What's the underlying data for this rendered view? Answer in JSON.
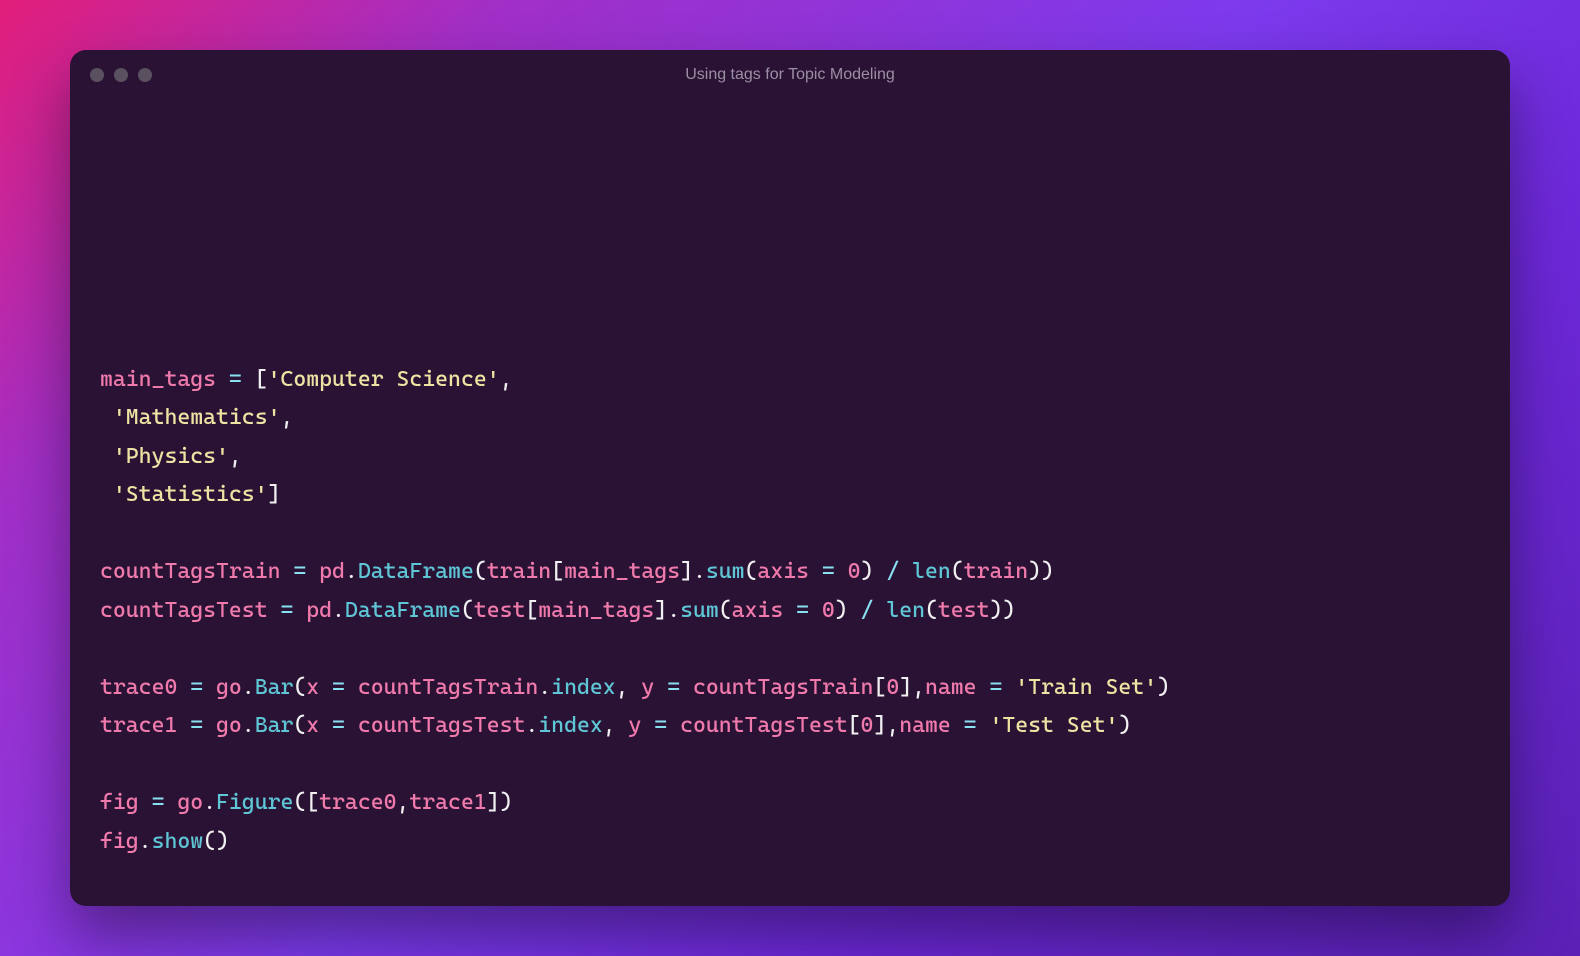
{
  "window": {
    "title": "Using tags for Topic Modeling"
  },
  "code": {
    "tokens": [
      [
        {
          "t": "",
          "c": "\n"
        }
      ],
      [
        {
          "t": "",
          "c": "\n"
        }
      ],
      [
        {
          "t": "",
          "c": "\n"
        }
      ],
      [
        {
          "t": "var",
          "c": "main_tags"
        },
        {
          "t": "",
          "c": " "
        },
        {
          "t": "op",
          "c": "="
        },
        {
          "t": "",
          "c": " "
        },
        {
          "t": "punct",
          "c": "["
        },
        {
          "t": "str",
          "c": "'Computer Science'"
        },
        {
          "t": "punct",
          "c": ","
        }
      ],
      [
        {
          "t": "",
          "c": " "
        },
        {
          "t": "str",
          "c": "'Mathematics'"
        },
        {
          "t": "punct",
          "c": ","
        }
      ],
      [
        {
          "t": "",
          "c": " "
        },
        {
          "t": "str",
          "c": "'Physics'"
        },
        {
          "t": "punct",
          "c": ","
        }
      ],
      [
        {
          "t": "",
          "c": " "
        },
        {
          "t": "str",
          "c": "'Statistics'"
        },
        {
          "t": "punct",
          "c": "]"
        }
      ],
      [
        {
          "t": "",
          "c": ""
        }
      ],
      [
        {
          "t": "var",
          "c": "countTagsTrain"
        },
        {
          "t": "",
          "c": " "
        },
        {
          "t": "op",
          "c": "="
        },
        {
          "t": "",
          "c": " "
        },
        {
          "t": "obj",
          "c": "pd"
        },
        {
          "t": "punct",
          "c": "."
        },
        {
          "t": "method",
          "c": "DataFrame"
        },
        {
          "t": "punct",
          "c": "("
        },
        {
          "t": "obj",
          "c": "train"
        },
        {
          "t": "punct",
          "c": "["
        },
        {
          "t": "var",
          "c": "main_tags"
        },
        {
          "t": "punct",
          "c": "]"
        },
        {
          "t": "punct",
          "c": "."
        },
        {
          "t": "method",
          "c": "sum"
        },
        {
          "t": "punct",
          "c": "("
        },
        {
          "t": "param",
          "c": "axis"
        },
        {
          "t": "",
          "c": " "
        },
        {
          "t": "op",
          "c": "="
        },
        {
          "t": "",
          "c": " "
        },
        {
          "t": "num",
          "c": "0"
        },
        {
          "t": "punct",
          "c": ")"
        },
        {
          "t": "",
          "c": " "
        },
        {
          "t": "op",
          "c": "/"
        },
        {
          "t": "",
          "c": " "
        },
        {
          "t": "func",
          "c": "len"
        },
        {
          "t": "punct",
          "c": "("
        },
        {
          "t": "obj",
          "c": "train"
        },
        {
          "t": "punct",
          "c": "))"
        }
      ],
      [
        {
          "t": "var",
          "c": "countTagsTest"
        },
        {
          "t": "",
          "c": " "
        },
        {
          "t": "op",
          "c": "="
        },
        {
          "t": "",
          "c": " "
        },
        {
          "t": "obj",
          "c": "pd"
        },
        {
          "t": "punct",
          "c": "."
        },
        {
          "t": "method",
          "c": "DataFrame"
        },
        {
          "t": "punct",
          "c": "("
        },
        {
          "t": "obj",
          "c": "test"
        },
        {
          "t": "punct",
          "c": "["
        },
        {
          "t": "var",
          "c": "main_tags"
        },
        {
          "t": "punct",
          "c": "]"
        },
        {
          "t": "punct",
          "c": "."
        },
        {
          "t": "method",
          "c": "sum"
        },
        {
          "t": "punct",
          "c": "("
        },
        {
          "t": "param",
          "c": "axis"
        },
        {
          "t": "",
          "c": " "
        },
        {
          "t": "op",
          "c": "="
        },
        {
          "t": "",
          "c": " "
        },
        {
          "t": "num",
          "c": "0"
        },
        {
          "t": "punct",
          "c": ")"
        },
        {
          "t": "",
          "c": " "
        },
        {
          "t": "op",
          "c": "/"
        },
        {
          "t": "",
          "c": " "
        },
        {
          "t": "func",
          "c": "len"
        },
        {
          "t": "punct",
          "c": "("
        },
        {
          "t": "obj",
          "c": "test"
        },
        {
          "t": "punct",
          "c": "))"
        }
      ],
      [
        {
          "t": "",
          "c": ""
        }
      ],
      [
        {
          "t": "var",
          "c": "trace0"
        },
        {
          "t": "",
          "c": " "
        },
        {
          "t": "op",
          "c": "="
        },
        {
          "t": "",
          "c": " "
        },
        {
          "t": "obj",
          "c": "go"
        },
        {
          "t": "punct",
          "c": "."
        },
        {
          "t": "method",
          "c": "Bar"
        },
        {
          "t": "punct",
          "c": "("
        },
        {
          "t": "param",
          "c": "x"
        },
        {
          "t": "",
          "c": " "
        },
        {
          "t": "op",
          "c": "="
        },
        {
          "t": "",
          "c": " "
        },
        {
          "t": "obj",
          "c": "countTagsTrain"
        },
        {
          "t": "punct",
          "c": "."
        },
        {
          "t": "method",
          "c": "index"
        },
        {
          "t": "punct",
          "c": ","
        },
        {
          "t": "",
          "c": " "
        },
        {
          "t": "param",
          "c": "y"
        },
        {
          "t": "",
          "c": " "
        },
        {
          "t": "op",
          "c": "="
        },
        {
          "t": "",
          "c": " "
        },
        {
          "t": "obj",
          "c": "countTagsTrain"
        },
        {
          "t": "punct",
          "c": "["
        },
        {
          "t": "num",
          "c": "0"
        },
        {
          "t": "punct",
          "c": "],"
        },
        {
          "t": "param",
          "c": "name"
        },
        {
          "t": "",
          "c": " "
        },
        {
          "t": "op",
          "c": "="
        },
        {
          "t": "",
          "c": " "
        },
        {
          "t": "str",
          "c": "'Train Set'"
        },
        {
          "t": "punct",
          "c": ")"
        }
      ],
      [
        {
          "t": "var",
          "c": "trace1"
        },
        {
          "t": "",
          "c": " "
        },
        {
          "t": "op",
          "c": "="
        },
        {
          "t": "",
          "c": " "
        },
        {
          "t": "obj",
          "c": "go"
        },
        {
          "t": "punct",
          "c": "."
        },
        {
          "t": "method",
          "c": "Bar"
        },
        {
          "t": "punct",
          "c": "("
        },
        {
          "t": "param",
          "c": "x"
        },
        {
          "t": "",
          "c": " "
        },
        {
          "t": "op",
          "c": "="
        },
        {
          "t": "",
          "c": " "
        },
        {
          "t": "obj",
          "c": "countTagsTest"
        },
        {
          "t": "punct",
          "c": "."
        },
        {
          "t": "method",
          "c": "index"
        },
        {
          "t": "punct",
          "c": ","
        },
        {
          "t": "",
          "c": " "
        },
        {
          "t": "param",
          "c": "y"
        },
        {
          "t": "",
          "c": " "
        },
        {
          "t": "op",
          "c": "="
        },
        {
          "t": "",
          "c": " "
        },
        {
          "t": "obj",
          "c": "countTagsTest"
        },
        {
          "t": "punct",
          "c": "["
        },
        {
          "t": "num",
          "c": "0"
        },
        {
          "t": "punct",
          "c": "],"
        },
        {
          "t": "param",
          "c": "name"
        },
        {
          "t": "",
          "c": " "
        },
        {
          "t": "op",
          "c": "="
        },
        {
          "t": "",
          "c": " "
        },
        {
          "t": "str",
          "c": "'Test Set'"
        },
        {
          "t": "punct",
          "c": ")"
        }
      ],
      [
        {
          "t": "",
          "c": ""
        }
      ],
      [
        {
          "t": "var",
          "c": "fig"
        },
        {
          "t": "",
          "c": " "
        },
        {
          "t": "op",
          "c": "="
        },
        {
          "t": "",
          "c": " "
        },
        {
          "t": "obj",
          "c": "go"
        },
        {
          "t": "punct",
          "c": "."
        },
        {
          "t": "method",
          "c": "Figure"
        },
        {
          "t": "punct",
          "c": "(["
        },
        {
          "t": "obj",
          "c": "trace0"
        },
        {
          "t": "punct",
          "c": ","
        },
        {
          "t": "obj",
          "c": "trace1"
        },
        {
          "t": "punct",
          "c": "])"
        }
      ],
      [
        {
          "t": "obj",
          "c": "fig"
        },
        {
          "t": "punct",
          "c": "."
        },
        {
          "t": "method",
          "c": "show"
        },
        {
          "t": "punct",
          "c": "()"
        }
      ]
    ]
  }
}
